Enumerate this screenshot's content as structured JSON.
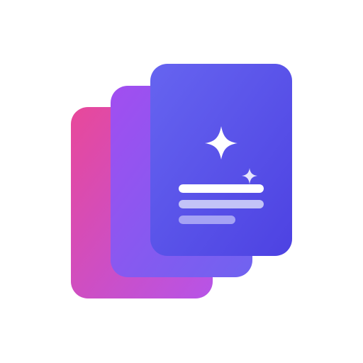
{
  "icon": {
    "name": "stacked-cards-sparkle-app-icon",
    "background": "#ffffff",
    "colors": {
      "back_card_top": "#e8489a",
      "back_card_bottom": "#b654e8",
      "middle_card_top": "#a24ef0",
      "middle_card_bottom": "#6f63f0",
      "front_card_top": "#6664f0",
      "front_card_bottom": "#4d42e2",
      "sparkle": "#ffffff",
      "line_primary": "#ffffff",
      "line_secondary": "#c3c3f7",
      "line_tertiary": "#a5a2f4"
    },
    "glyphs": [
      "sparkle-large-icon",
      "sparkle-small-icon"
    ]
  }
}
